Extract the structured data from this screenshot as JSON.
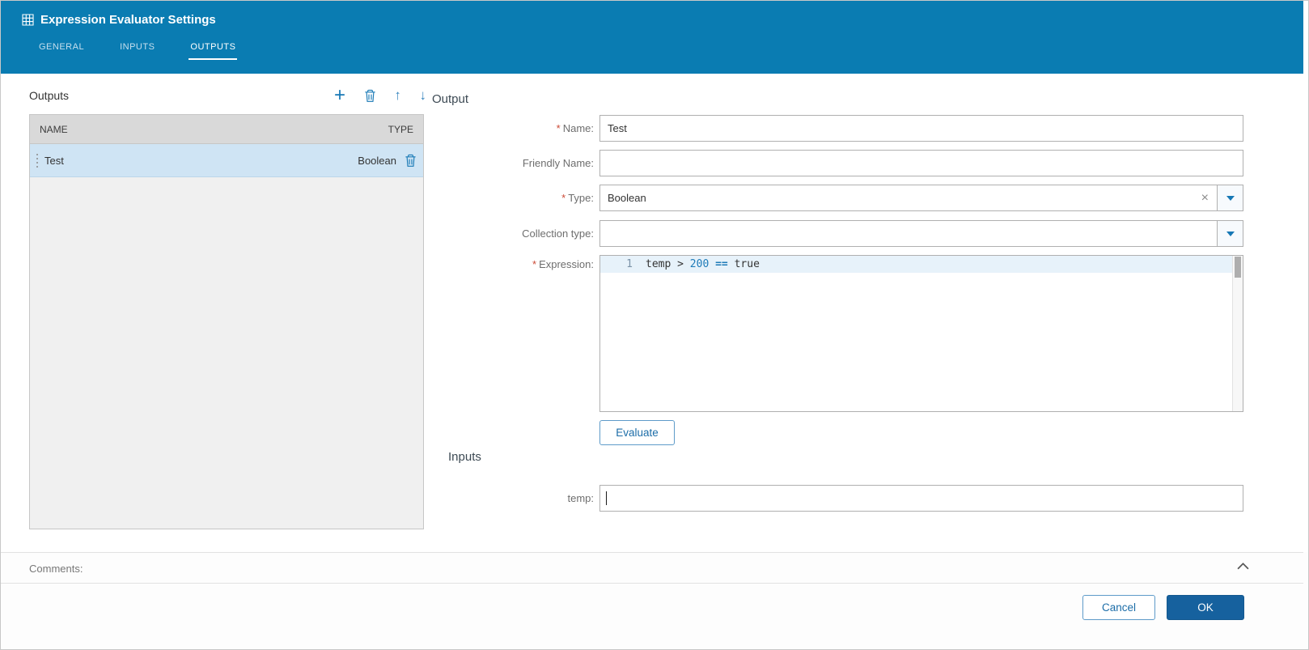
{
  "colors": {
    "header_bg": "#0a7cb2",
    "accent": "#1778b5",
    "selected_row_bg": "#cfe4f4",
    "ok_button_bg": "#16619e"
  },
  "header": {
    "title": "Expression Evaluator Settings",
    "tabs": [
      {
        "label": "GENERAL"
      },
      {
        "label": "INPUTS"
      },
      {
        "label": "OUTPUTS"
      }
    ],
    "active_tab": "OUTPUTS"
  },
  "icons": {
    "plus": "+",
    "arrow_up": "↑",
    "arrow_down": "↓",
    "clear": "×"
  },
  "outputs_panel": {
    "title": "Outputs",
    "columns": {
      "name": "NAME",
      "type": "TYPE"
    },
    "rows": [
      {
        "name": "Test",
        "type": "Boolean",
        "selected": true
      }
    ]
  },
  "output_form": {
    "title": "Output",
    "name": {
      "label": "Name:",
      "required": "*",
      "value": "Test"
    },
    "friendly_name": {
      "label": "Friendly Name:",
      "value": ""
    },
    "type": {
      "label": "Type:",
      "required": "*",
      "value": "Boolean"
    },
    "collection_type": {
      "label": "Collection type:",
      "value": ""
    },
    "expression": {
      "label": "Expression:",
      "required": "*",
      "line_number": "1",
      "code": "temp > 200 == true",
      "tokens": [
        {
          "text": "temp",
          "style": "plain"
        },
        {
          "text": " ",
          "style": "plain"
        },
        {
          "text": ">",
          "style": "plain"
        },
        {
          "text": " ",
          "style": "plain"
        },
        {
          "text": "200",
          "style": "number"
        },
        {
          "text": " ",
          "style": "plain"
        },
        {
          "text": "==",
          "style": "operator"
        },
        {
          "text": " ",
          "style": "plain"
        },
        {
          "text": "true",
          "style": "plain"
        }
      ]
    },
    "evaluate_label": "Evaluate"
  },
  "inputs_section": {
    "title": "Inputs",
    "temp": {
      "label": "temp:",
      "value": ""
    }
  },
  "comments": {
    "label": "Comments:"
  },
  "footer": {
    "cancel": "Cancel",
    "ok": "OK"
  }
}
